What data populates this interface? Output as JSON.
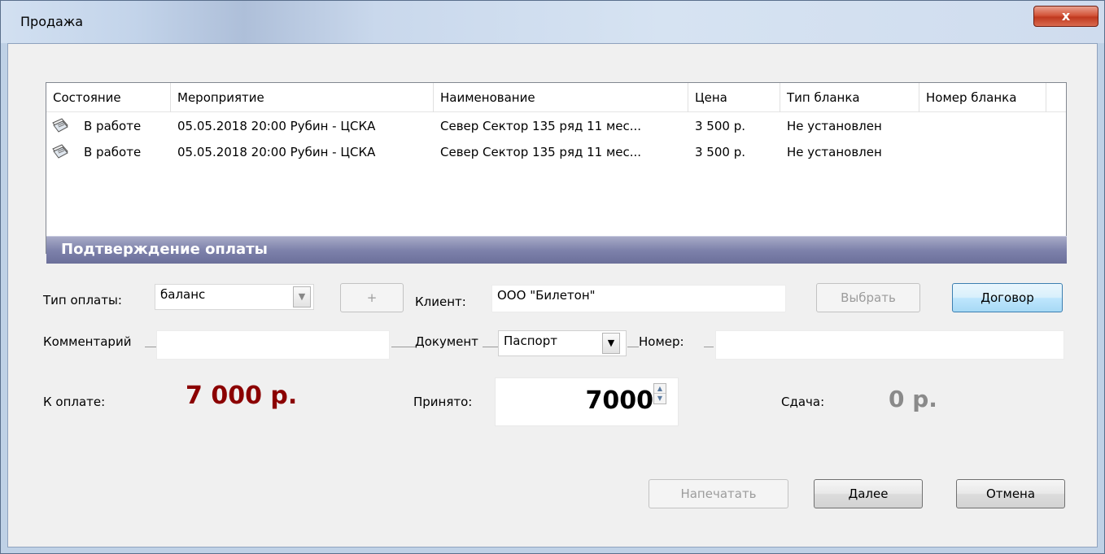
{
  "window": {
    "title": "Продажа",
    "close_label": "x"
  },
  "table": {
    "columns": [
      "Состояние",
      "Мероприятие",
      "Наименование",
      "Цена",
      "Тип бланка",
      "Номер бланка"
    ],
    "rows": [
      {
        "status": "В работе",
        "event": "05.05.2018 20:00 Рубин - ЦСКА",
        "name": "Север Сектор 135 ряд 11 мес...",
        "price": "3 500 р.",
        "blank_type": "Не установлен",
        "blank_number": ""
      },
      {
        "status": "В работе",
        "event": "05.05.2018 20:00 Рубин - ЦСКА",
        "name": "Север Сектор 135 ряд 11 мес...",
        "price": "3 500 р.",
        "blank_type": "Не установлен",
        "blank_number": ""
      }
    ],
    "row_icon": "ticket-icon"
  },
  "section": {
    "title": "Подтверждение оплаты"
  },
  "payment": {
    "type_label": "Тип оплаты:",
    "type_value": "баланс",
    "add_label": "+",
    "client_label": "Клиент:",
    "client_value": "ООО \"Билетон\"",
    "select_label": "Выбрать",
    "contract_label": "Договор",
    "comment_label": "Комментарий",
    "comment_value": "",
    "document_label": "Документ",
    "document_value": "Паспорт",
    "number_label": "Номер:",
    "number_value": "",
    "to_pay_label": "К оплате:",
    "to_pay_value": "7 000 р.",
    "accepted_label": "Принято:",
    "accepted_value": "7000",
    "change_label": "Сдача:",
    "change_value": "0 р.",
    "to_pay_color": "#8b0000",
    "change_color": "#8a8a8a"
  },
  "footer": {
    "print_label": "Напечатать",
    "next_label": "Далее",
    "cancel_label": "Отмена"
  }
}
